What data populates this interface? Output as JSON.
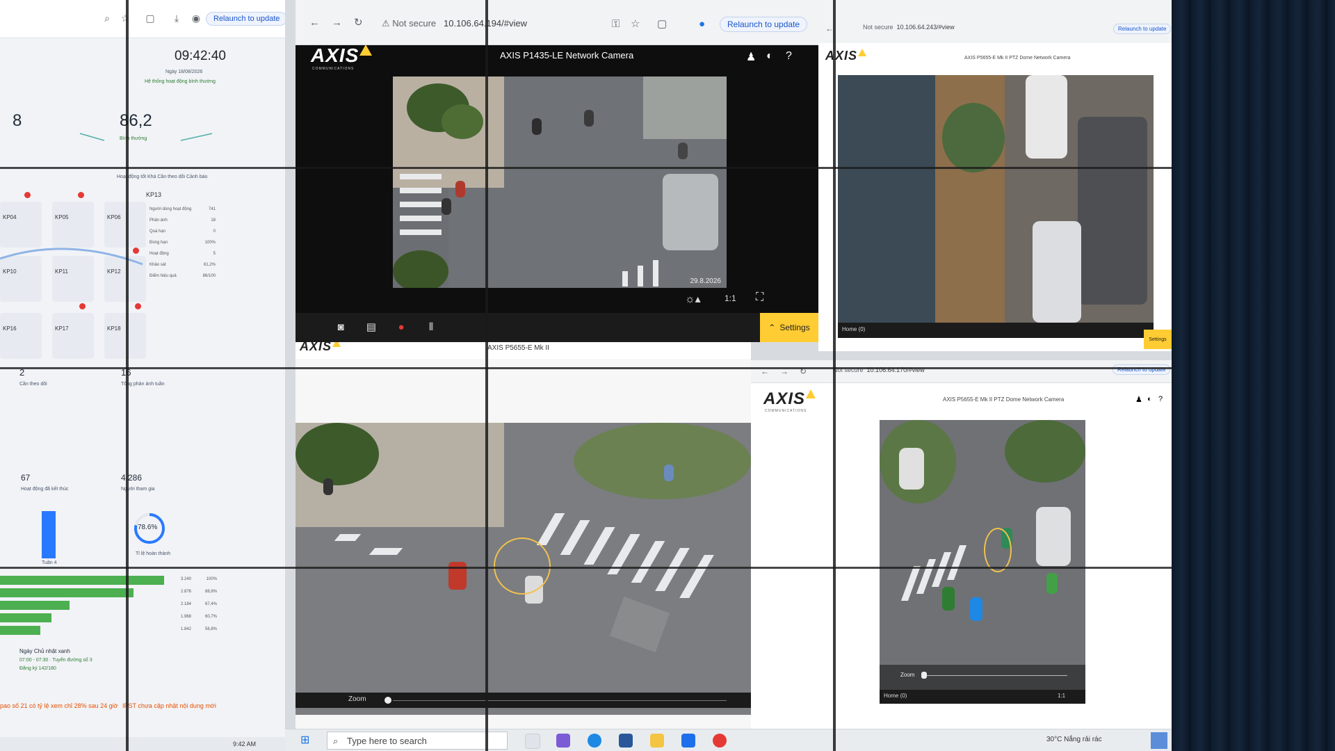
{
  "dashboard": {
    "relaunch_label": "Relaunch to update",
    "clock": "09:42:40",
    "date_line": "Ngày 18/08/2026",
    "status_line": "Hệ thống hoạt động bình thường",
    "stat_left_value": "8",
    "stat_right_value": "86,2",
    "stat_right_sub": "Bình thường",
    "legend": "Hoạt động tốt  Khá  Cần theo dõi  Cảnh báo",
    "nodes": [
      "KP04",
      "KP05",
      "KP06",
      "KP10",
      "KP11",
      "KP12",
      "KP16",
      "KP17",
      "KP18"
    ],
    "kp13": {
      "title": "KP13",
      "rows": [
        {
          "label": "Người dùng hoạt động",
          "value": "741"
        },
        {
          "label": "Phản ánh",
          "value": "18"
        },
        {
          "label": "Quá hạn",
          "value": "0"
        },
        {
          "label": "Đúng hạn",
          "value": "100%"
        },
        {
          "label": "Hoạt động",
          "value": "5"
        },
        {
          "label": "Khảo sát",
          "value": "61,2%"
        },
        {
          "label": "Điểm hiệu quả",
          "value": "86/100"
        }
      ]
    },
    "mid_left_value": "2",
    "mid_left_label": "Cần theo dõi",
    "mid_right_value": "16",
    "mid_right_label": "Tổng phản ánh tuần",
    "low_left_value": "67",
    "low_left_label": "Hoạt động đã kết thúc",
    "low_right_value": "4.286",
    "low_right_label": "Người tham gia",
    "donut_value": "78.6%",
    "donut_label": "Tỉ lệ hoàn thành",
    "bar_label": "Tuần 4",
    "hbar_values": [
      {
        "value": "3.240",
        "pct": "100%"
      },
      {
        "value": "2.876",
        "pct": "88,8%"
      },
      {
        "value": "2.184",
        "pct": "67,4%"
      },
      {
        "value": "1.968",
        "pct": "60,7%"
      },
      {
        "value": "1.842",
        "pct": "56,8%"
      }
    ],
    "bottom_title": "Ngày Chủ nhật xanh",
    "bottom_line1": "07:00 - 07:30 · Tuyến đường số 3",
    "bottom_line2": "Đăng ký 142/180",
    "footer_red": "pao số 21 có tỷ lệ xem chỉ 28% sau 24 giờ",
    "footer_red2": "IPST chưa cập nhật nội dung mới",
    "taskbar_time": "9:42 AM",
    "donut_fraction": 0.786
  },
  "cam_main": {
    "not_secure": "Not secure",
    "url": "10.106.64.194/#view",
    "relaunch": "Relaunch to update",
    "logo": "AXIS",
    "logo_sub": "COMMUNICATIONS",
    "title": "AXIS P1435-LE Network Camera",
    "timestamp": "29.8.2026",
    "ratio": "1:1",
    "settings": "Settings"
  },
  "cam_right": {
    "not_secure": "Not secure",
    "url": "10.106.64.243/#view",
    "relaunch": "Relaunch to update",
    "title": "AXIS P5655-E Mk II PTZ Dome Network Camera",
    "settings": "Settings",
    "home": "Home (0)"
  },
  "cam_bottom_left": {
    "title": "AXIS P5655-E Mk II",
    "zoom": "Zoom"
  },
  "cam_bottom_right": {
    "not_secure": "Not secure",
    "url": "10.106.64.170/#view",
    "relaunch": "Relaunch to update",
    "logo": "AXIS",
    "logo_sub": "COMMUNICATIONS",
    "title": "AXIS P5655-E Mk II PTZ Dome Network Camera",
    "zoom": "Zoom",
    "home": "Home (0)",
    "ratio": "1:1"
  },
  "taskbar": {
    "search_placeholder": "Type here to search",
    "weather": "30°C Nắng rải rác",
    "ratio": "1:1"
  }
}
